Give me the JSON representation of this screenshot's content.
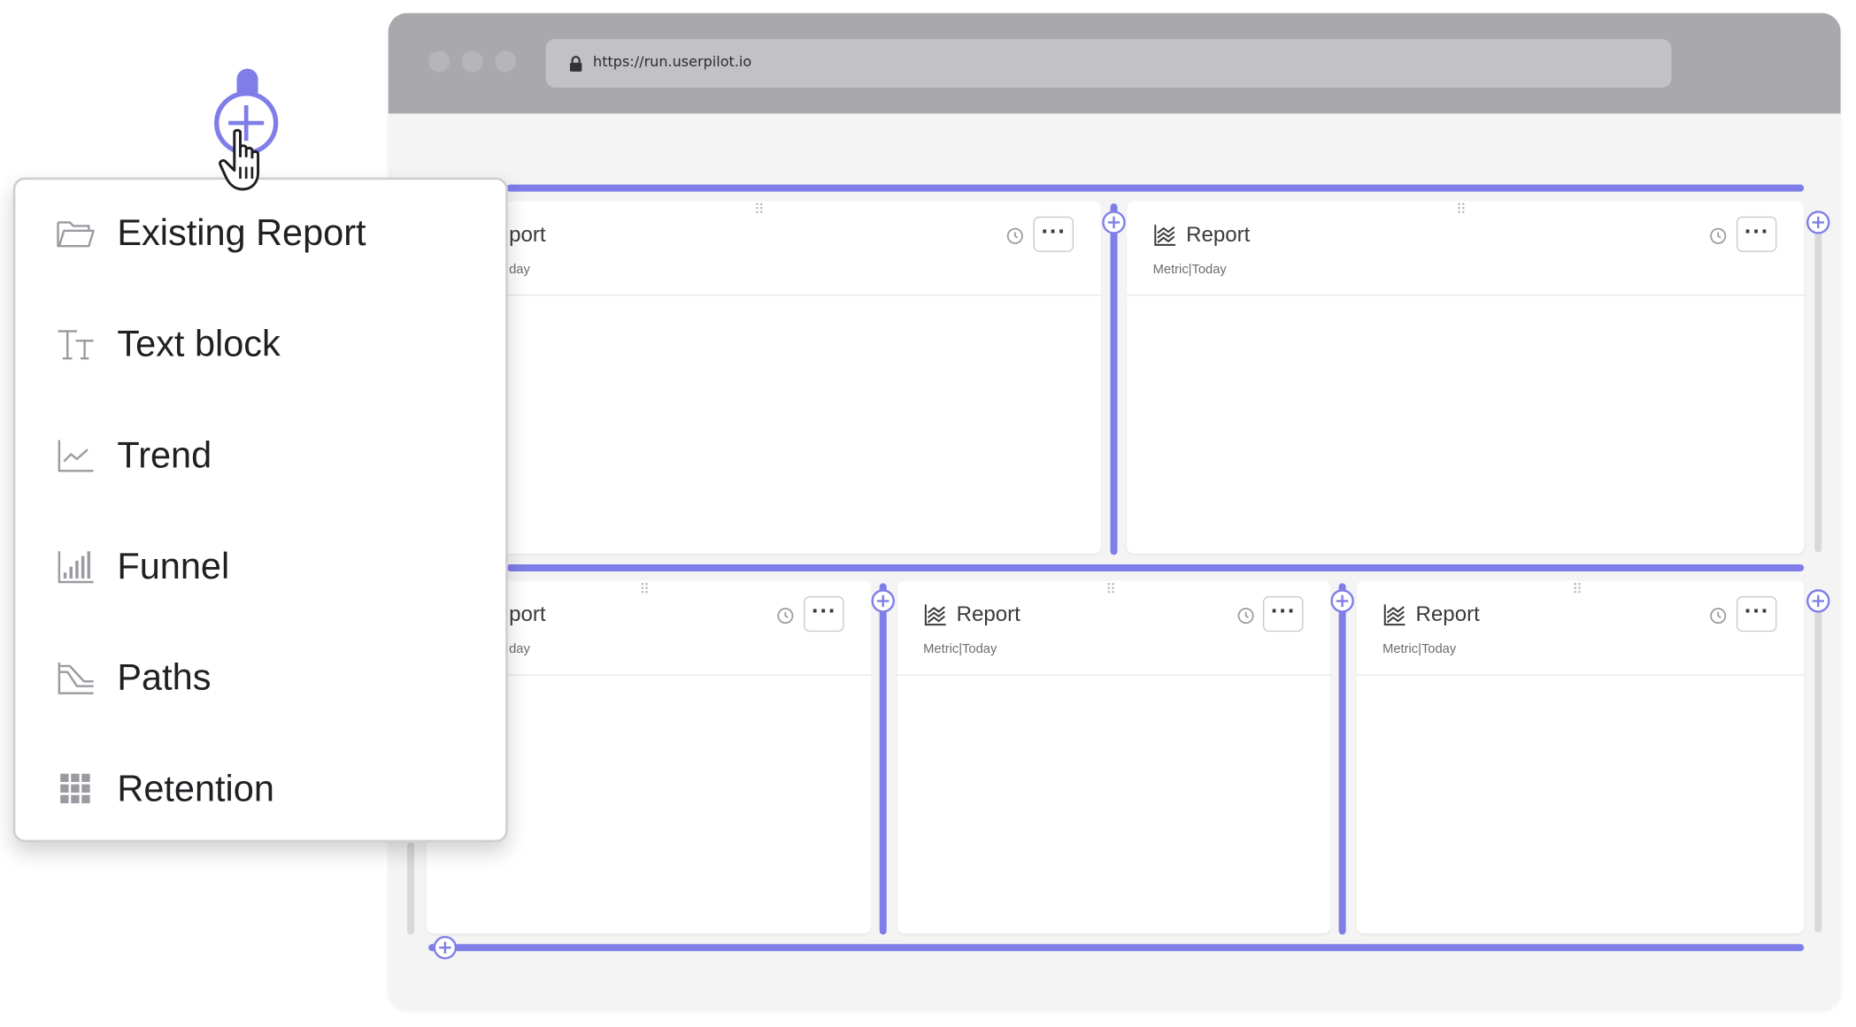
{
  "browser": {
    "url": "https://run.userpilot.io"
  },
  "cards": [
    {
      "title": "port",
      "subtitle": "day"
    },
    {
      "title": "Report",
      "subtitle": "Metric|Today"
    },
    {
      "title": "port",
      "subtitle": "day"
    },
    {
      "title": "Report",
      "subtitle": "Metric|Today"
    },
    {
      "title": "Report",
      "subtitle": "Metric|Today"
    }
  ],
  "more_label": "···",
  "menu": {
    "items": [
      {
        "label": "Existing Report",
        "icon": "folder-icon"
      },
      {
        "label": "Text block",
        "icon": "text-block-icon"
      },
      {
        "label": "Trend",
        "icon": "trend-icon"
      },
      {
        "label": "Funnel",
        "icon": "funnel-icon"
      },
      {
        "label": "Paths",
        "icon": "paths-icon"
      },
      {
        "label": "Retention",
        "icon": "retention-icon"
      }
    ]
  },
  "colors": {
    "accent": "#7f7ee8",
    "chrome": "#a9a9ad",
    "canvas": "#f4f4f5"
  }
}
